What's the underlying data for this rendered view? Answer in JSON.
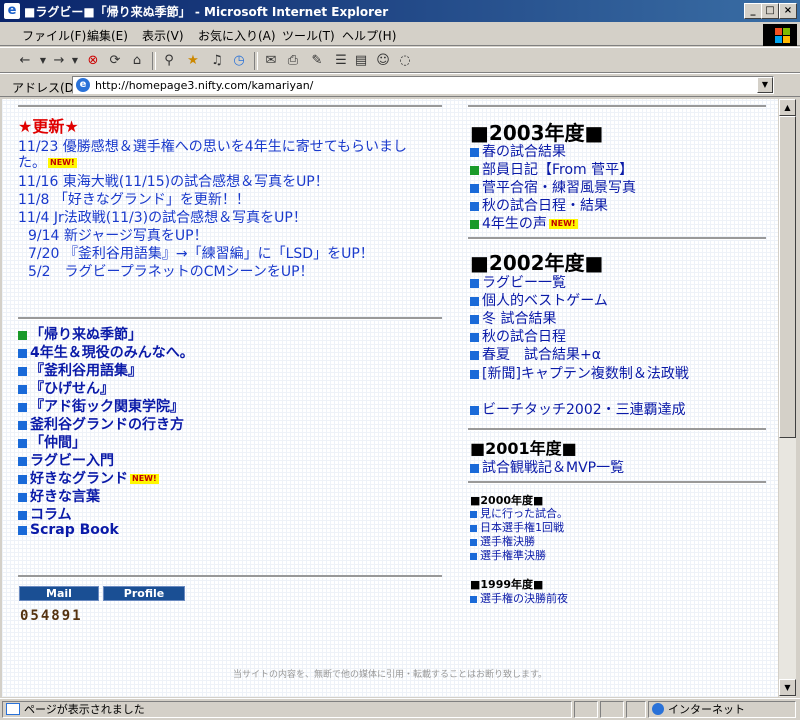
{
  "window": {
    "title": "■ラグビー■「帰り来ぬ季節」 - Microsoft Internet Explorer",
    "min": "_",
    "max": "□",
    "close": "×"
  },
  "menu": [
    "ファイル(F)",
    "編集(E)",
    "表示(V)",
    "お気に入り(A)",
    "ツール(T)",
    "ヘルプ(H)"
  ],
  "address": {
    "label": "アドレス(D)",
    "url": "http://homepage3.nifty.com/kamariyan/"
  },
  "status": {
    "text": "ページが表示されました",
    "zone": "インターネット"
  },
  "page": {
    "updates_title": "★更新★",
    "new_badge": "NEW!",
    "updates": [
      "11/23 優勝感想＆選手権への思いを4年生に寄せてもらいまし",
      "た。",
      "11/16 東海大戦(11/15)の試合感想＆写真をUP！",
      "11/8 「好きなグランド」を更新！！",
      "11/4 Jr法政戦(11/3)の試合感想＆写真をUP！",
      "9/14 新ジャージ写真をUP！",
      "7/20 『釜利谷用語集』→「練習編」に「LSD」をUP！",
      "5/2　ラグビープラネットのCMシーンをUP！"
    ],
    "nav": [
      "「帰り来ぬ季節」",
      "4年生＆現役のみんなへ。",
      "『釜利谷用語集』",
      "『ひげせん』",
      "『アド街ック関東学院』",
      "釜利谷グランドの行き方",
      "「仲間」",
      "ラグビー入門",
      "好きなグランド",
      "好きな言葉",
      "コラム",
      "Scrap Book"
    ],
    "mail_label": "Mail",
    "profile_label": "Profile",
    "counter": "054891",
    "y2003_title": "■2003年度■",
    "y2003": [
      "春の試合結果",
      "部員日記【From 菅平】",
      "菅平合宿・練習風景写真",
      "秋の試合日程・結果",
      "4年生の声"
    ],
    "y2002_title": "■2002年度■",
    "y2002": [
      "ラグビー一覧",
      "個人的ベストゲーム",
      "冬 試合結果",
      "秋の試合日程",
      "春夏　試合結果+α",
      "[新聞]キャプテン複数制＆法政戦",
      "ビーチタッチ2002・三連覇達成"
    ],
    "y2001_title": "■2001年度■",
    "y2001": [
      "試合観戦記＆MVP一覧"
    ],
    "y2000_title": "■2000年度■",
    "y2000": [
      "見に行った試合。",
      "日本選手権1回戦",
      "選手権決勝",
      "選手権準決勝"
    ],
    "y1999_title": "■1999年度■",
    "y1999": [
      "選手権の決勝前夜"
    ],
    "footer": "当サイトの内容を、無断で他の媒体に引用・転載することはお断り致します。"
  },
  "colors": {
    "title_bar": "#0a246a",
    "link": "#0a1aa8",
    "update_text": "#1a3acc",
    "accent_red": "#e00000",
    "square_blue": "#1a6ad8",
    "square_green": "#1a9a2a"
  }
}
